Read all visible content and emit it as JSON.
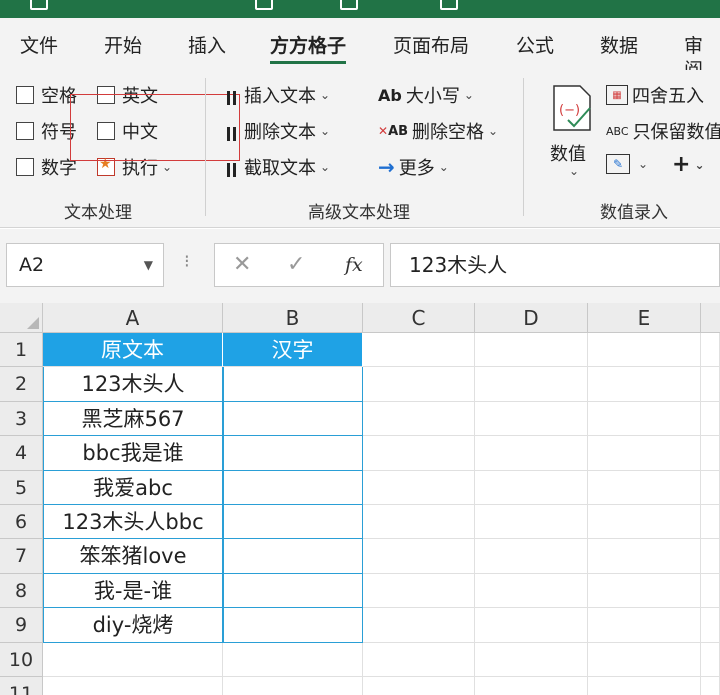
{
  "menu": {
    "tabs": [
      "文件",
      "开始",
      "插入",
      "方方格子",
      "页面布局",
      "公式",
      "数据",
      "审阅"
    ],
    "active": "方方格子"
  },
  "ribbon": {
    "text_group": {
      "checkboxes": [
        "空格",
        "英文",
        "符号",
        "中文",
        "数字"
      ],
      "execute": "执行",
      "label": "文本处理"
    },
    "adv_group": {
      "insert_text": "插入文本",
      "delete_text": "删除文本",
      "extract_text": "截取文本",
      "case": "大小写",
      "delete_spaces": "删除空格",
      "more": "更多",
      "case_icon": "Ab",
      "del_space_icon": "AB",
      "label": "高级文本处理"
    },
    "num_group": {
      "value": "数值",
      "round": "四舍五入",
      "keep_value": "只保留数值",
      "abc": "ABC",
      "plus": "+",
      "label": "数值录入"
    }
  },
  "formula_bar": {
    "name_box": "A2",
    "fx": "fx",
    "content": "123木头人"
  },
  "sheet": {
    "columns": [
      "A",
      "B",
      "C",
      "D",
      "E"
    ],
    "rows": [
      "1",
      "2",
      "3",
      "4",
      "5",
      "6",
      "7",
      "8",
      "9",
      "10",
      "11"
    ],
    "header_a": "原文本",
    "header_b": "汉字",
    "col_a_values": [
      "123木头人",
      "黑芝麻567",
      "bbc我是谁",
      "我爱abc",
      "123木头人bbc",
      "笨笨猪love",
      "我-是-谁",
      "diy-烧烤"
    ]
  },
  "colors": {
    "excel_green": "#217346",
    "table_header": "#1fa2e5",
    "annotation_red": "#d23b3b"
  }
}
